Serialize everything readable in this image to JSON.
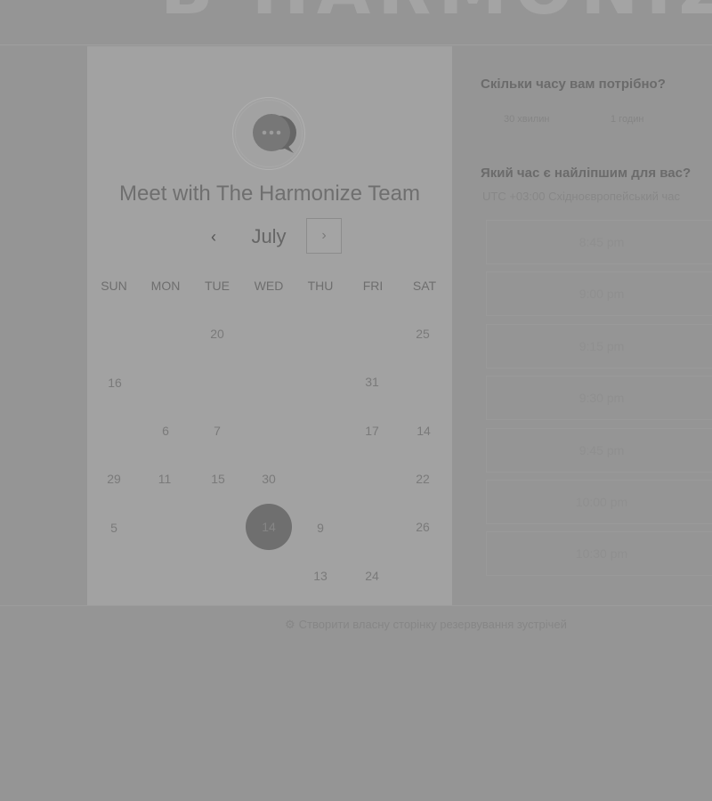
{
  "header": {
    "logo_text": "B HARMONIZE"
  },
  "card": {
    "title": "Meet with The Harmonize Team",
    "avatar_icon": "chat-bubble-icon",
    "calendar": {
      "month": "July",
      "prev_icon": "‹",
      "next_icon": "›",
      "weekdays": [
        "SUN",
        "MON",
        "TUE",
        "WED",
        "THU",
        "FRI",
        "SAT"
      ],
      "days": [
        "20",
        "25",
        "16",
        "31",
        "6",
        "7",
        "17",
        "14",
        "29",
        "11",
        "15",
        "30",
        "22",
        "5",
        "14",
        "9",
        "26",
        "13",
        "24"
      ],
      "selected_day": "14"
    }
  },
  "booking": {
    "duration_question": "Скільки часу вам потрібно?",
    "durations": [
      "30 хвилин",
      "1 годин"
    ],
    "time_question": "Який час є найліпшим для вас?",
    "timezone": "UTC +03:00 Східноєвропейський час",
    "slots": [
      "8:45 pm",
      "9:00 pm",
      "9:15 pm",
      "9:30 pm",
      "9:45 pm",
      "10:00 pm",
      "10:30 pm"
    ]
  },
  "footer": {
    "icon": "hubspot-sprocket-icon",
    "link_text": "Створити власну сторінку резервування зустрічей"
  }
}
